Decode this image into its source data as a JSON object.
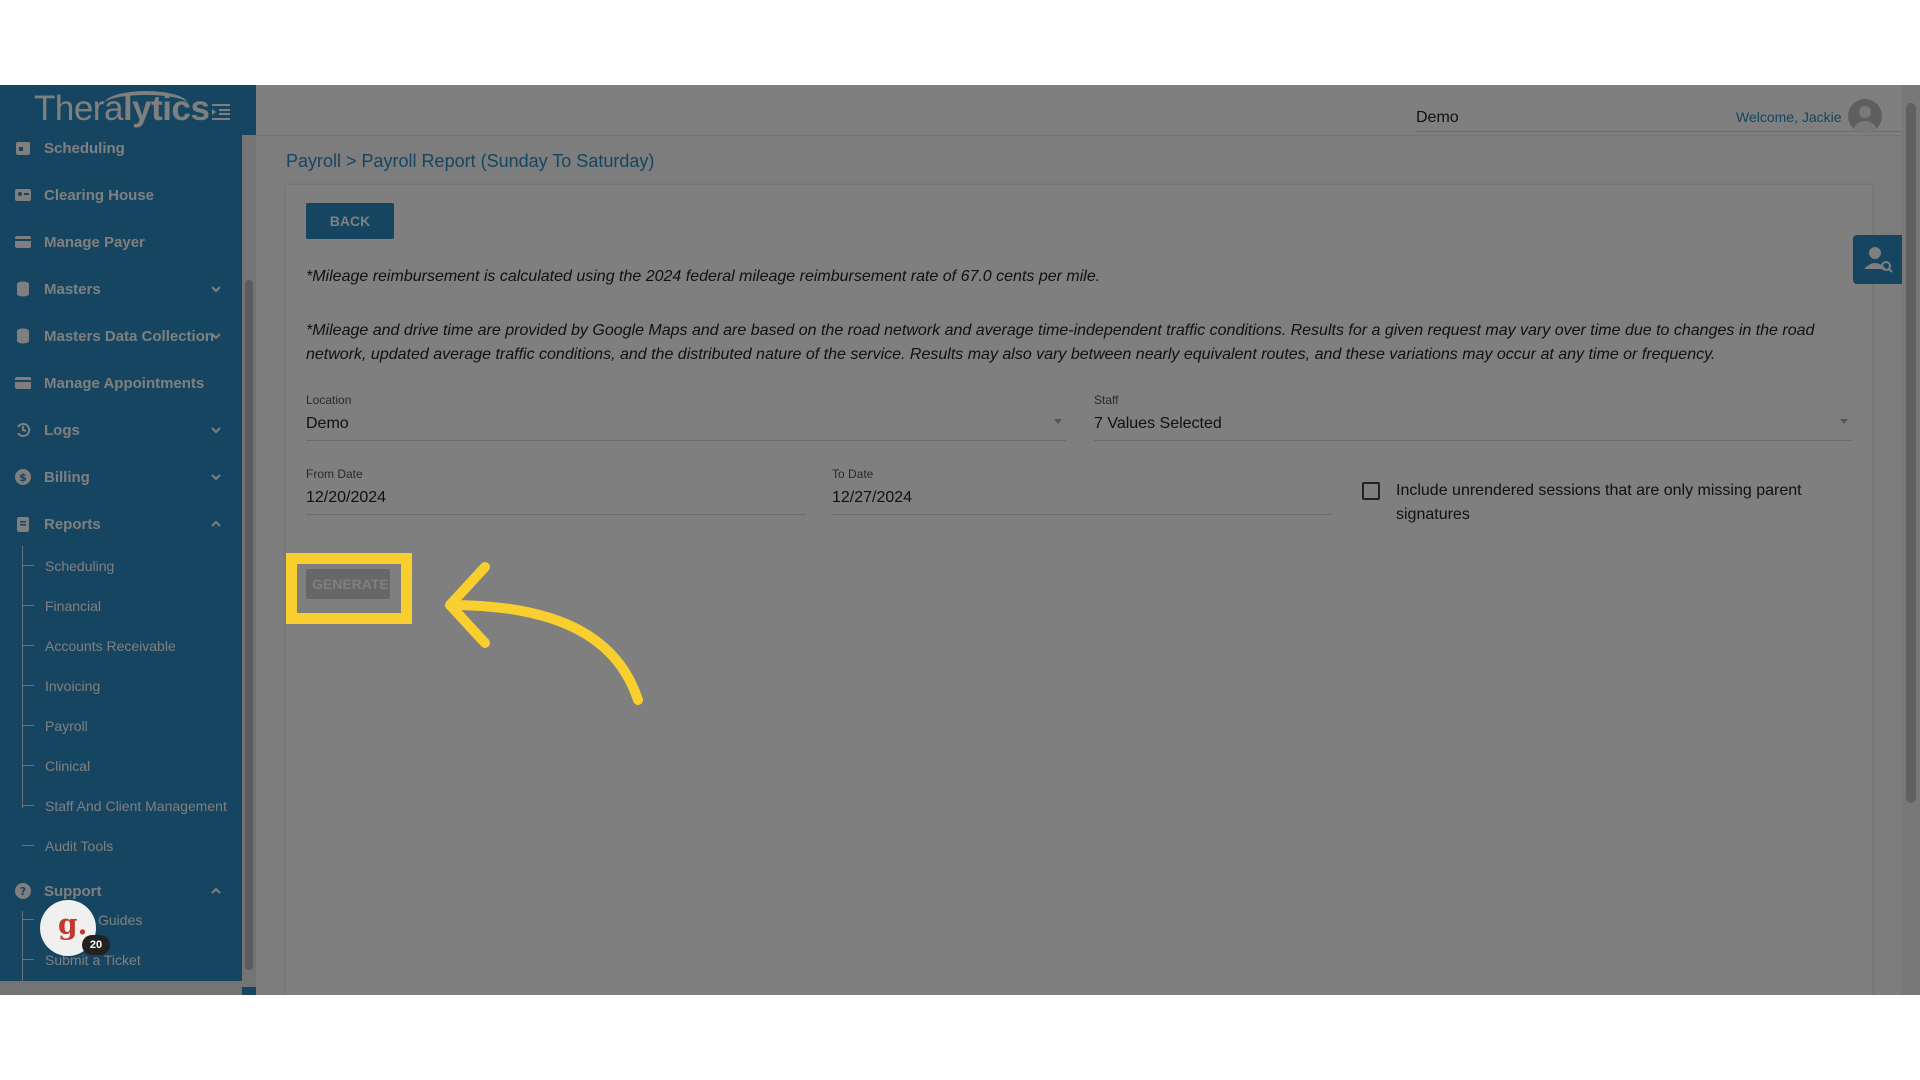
{
  "sidebar": {
    "logo_light": "Thera",
    "logo_bold": "lytics",
    "items": [
      {
        "label": "Scheduling",
        "icon": "calendar-icon",
        "chevron": ""
      },
      {
        "label": "Clearing House",
        "icon": "id-card-icon",
        "chevron": ""
      },
      {
        "label": "Manage Payer",
        "icon": "payer-card-icon",
        "chevron": ""
      },
      {
        "label": "Masters",
        "icon": "database-icon",
        "chevron": "down"
      },
      {
        "label": "Masters Data Collection",
        "icon": "database-icon",
        "chevron": "down"
      },
      {
        "label": "Manage Appointments",
        "icon": "appointments-icon",
        "chevron": ""
      },
      {
        "label": "Logs",
        "icon": "history-icon",
        "chevron": "down"
      },
      {
        "label": "Billing",
        "icon": "dollar-icon",
        "chevron": "down"
      },
      {
        "label": "Reports",
        "icon": "clipboard-icon",
        "chevron": "up"
      }
    ],
    "reports_children": [
      "Scheduling",
      "Financial",
      "Accounts Receivable",
      "Invoicing",
      "Payroll",
      "Clinical",
      "Staff And Client Management",
      "Audit Tools"
    ],
    "support": {
      "label": "Support",
      "icon": "help-circle-icon",
      "chevron": "up"
    },
    "support_children": [
      "Guides",
      "Submit a Ticket"
    ]
  },
  "header": {
    "org_select_value": "Demo",
    "welcome": "Welcome, Jackie"
  },
  "main": {
    "breadcrumb": "Payroll > Payroll Report (Sunday To Saturday)",
    "back_label": "BACK",
    "note1": "*Mileage reimbursement is calculated using the 2024 federal mileage reimbursement rate of 67.0 cents per mile.",
    "note2": "*Mileage and drive time are provided by Google Maps and are based on the road network and average time-independent traffic conditions. Results for a given request may vary over time due to changes in the road network, updated average traffic conditions, and the distributed nature of the service. Results may also vary between nearly equivalent routes, and these variations may occur at any time or frequency.",
    "location": {
      "label": "Location",
      "value": "Demo"
    },
    "staff": {
      "label": "Staff",
      "value": "7 Values Selected"
    },
    "from_date": {
      "label": "From Date",
      "value": "12/20/2024"
    },
    "to_date": {
      "label": "To Date",
      "value": "12/27/2024"
    },
    "include_unrendered": {
      "label": "Include unrendered sessions that are only missing parent signatures",
      "checked": false
    },
    "generate_label": "GENERATE"
  },
  "guide_widget": {
    "letter": "g.",
    "badge": "20"
  },
  "colors": {
    "brand": "#2a8bc2",
    "highlight": "#f9cf2f",
    "overlay": "rgba(0,0,0,0.5)"
  }
}
